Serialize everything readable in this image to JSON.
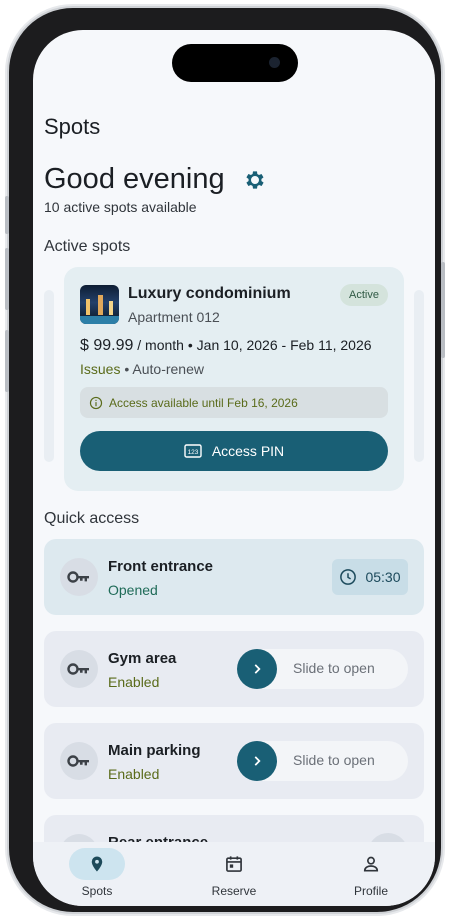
{
  "app": {
    "title": "Spots"
  },
  "header": {
    "greeting": "Good evening",
    "subtitle": "10 active spots available"
  },
  "sections": {
    "active": "Active spots",
    "quick": "Quick access"
  },
  "spot": {
    "name": "Luxury condominium",
    "unit": "Apartment 012",
    "badge": "Active",
    "price": "$ 99.99",
    "period": "/ month",
    "dates": "Jan 10, 2026 - Feb 11, 2026",
    "issues": "Issues",
    "renew": "Auto-renew",
    "notice": "Access available until Feb 16, 2026",
    "pin_label": "Access PIN",
    "pin_icon": "123"
  },
  "quick_access": [
    {
      "name": "Front entrance",
      "status": "Opened",
      "timer": "05:30"
    },
    {
      "name": "Gym area",
      "status": "Enabled",
      "slider": "Slide to open"
    },
    {
      "name": "Main parking",
      "status": "Enabled",
      "slider": "Slide to open"
    },
    {
      "name": "Rear entrance"
    }
  ],
  "nav": {
    "spots": "Spots",
    "reserve": "Reserve",
    "profile": "Profile"
  },
  "colors": {
    "accent": "#195f75",
    "status_enabled": "#5a6b1a",
    "status_opened": "#1f6b58",
    "badge_bg": "#d4e3dc"
  },
  "icons": [
    "gear-icon",
    "info-icon",
    "pin-pad-icon",
    "key-icon",
    "clock-icon",
    "chevron-right-icon",
    "location-pin-icon",
    "calendar-icon",
    "person-icon"
  ]
}
